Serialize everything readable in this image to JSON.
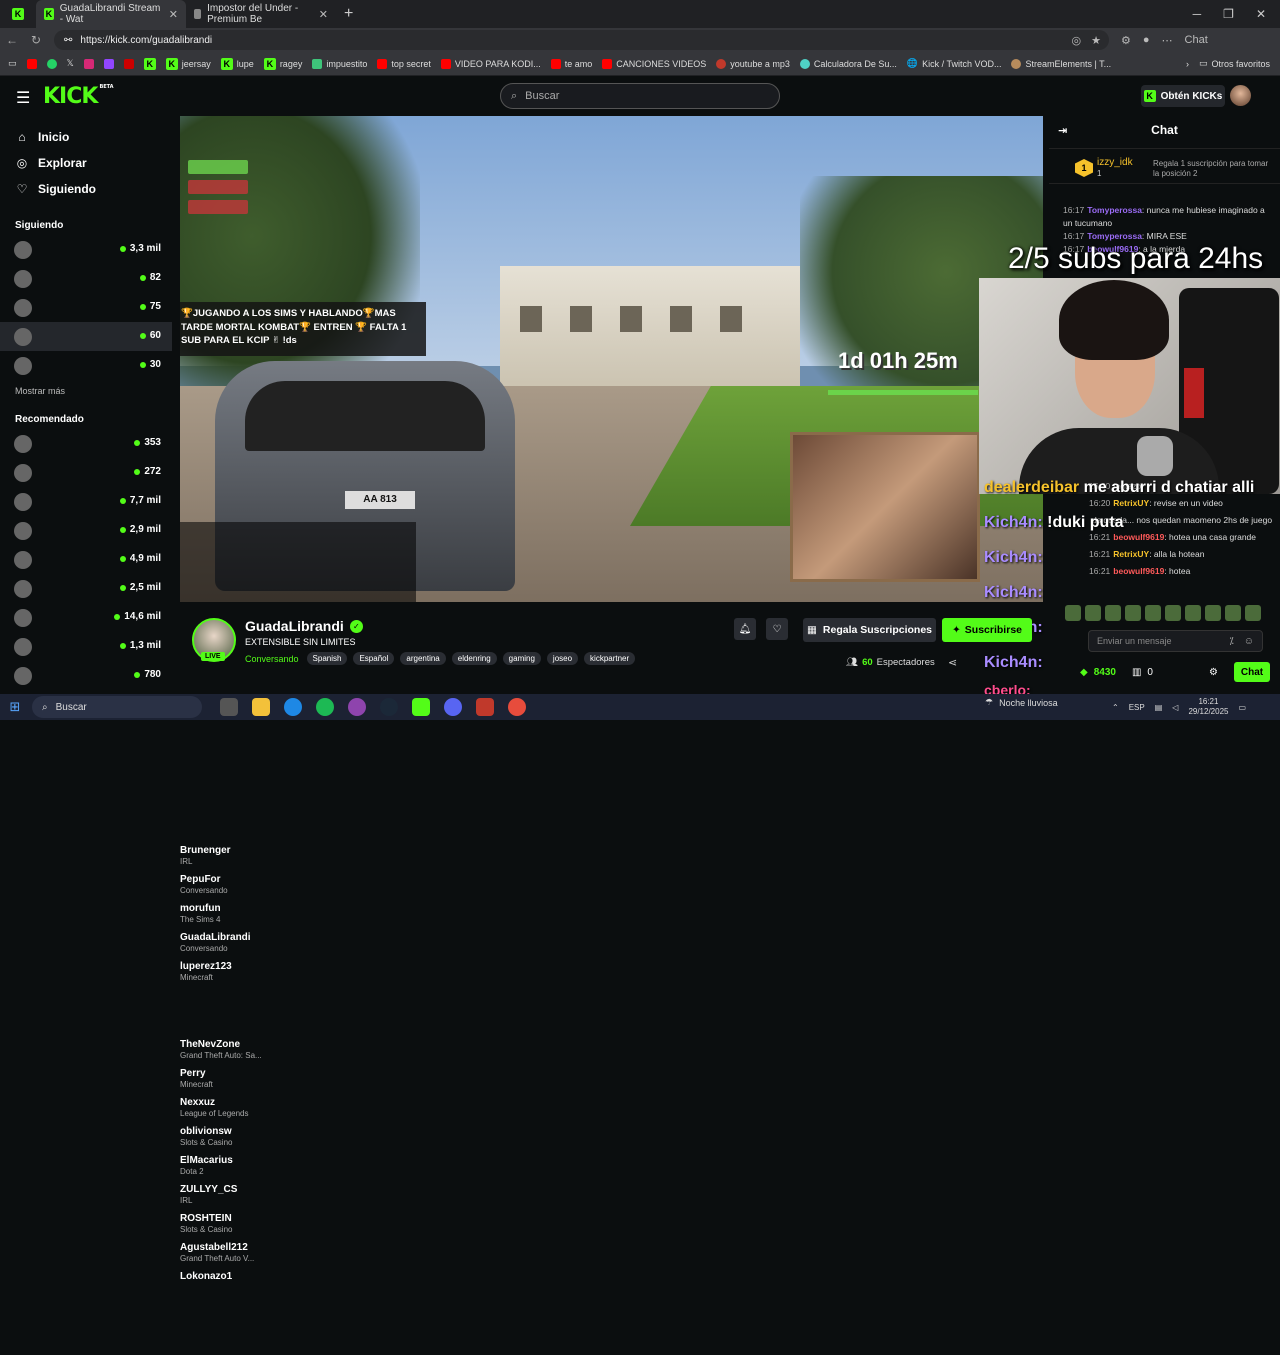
{
  "browser": {
    "tabs": [
      {
        "label": "GuadaLibrandi Stream - Wat",
        "active": true
      },
      {
        "label": "Impostor del Under - Premium Be",
        "active": false
      }
    ],
    "url": "https://kick.com/guadalibrandi",
    "chat_button": "Chat",
    "bookmarks": [
      "jeersay",
      "lupe",
      "ragey",
      "impuestito",
      "top secret",
      "VIDEO PARA KODI...",
      "te amo",
      "CANCIONES VIDEOS",
      "youtube a mp3",
      "Calculadora De Su...",
      "Kick / Twitch VOD...",
      "StreamElements | T..."
    ],
    "other_favorites": "Otros favoritos"
  },
  "header": {
    "logo": "KICK",
    "logo_badge": "BETA",
    "search_placeholder": "Buscar",
    "get_kicks": "Obtén KICKs"
  },
  "sidebar": {
    "nav": [
      {
        "label": "Inicio",
        "icon": "home-icon"
      },
      {
        "label": "Explorar",
        "icon": "compass-icon"
      },
      {
        "label": "Siguiendo",
        "icon": "heart-icon"
      }
    ],
    "following_title": "Siguiendo",
    "following": [
      {
        "name": "Brunenger",
        "sub": "IRL",
        "count": "3,3 mil"
      },
      {
        "name": "PepuFor",
        "sub": "Conversando",
        "count": "82"
      },
      {
        "name": "morufun",
        "sub": "The Sims 4",
        "count": "75"
      },
      {
        "name": "GuadaLibrandi",
        "sub": "Conversando",
        "count": "60"
      },
      {
        "name": "luperez123",
        "sub": "Minecraft",
        "count": "30"
      }
    ],
    "show_more": "Mostrar más",
    "recommended_title": "Recomendado",
    "recommended": [
      {
        "name": "TheNevZone",
        "sub": "Grand Theft Auto: Sa...",
        "count": "353"
      },
      {
        "name": "Perry",
        "sub": "Minecraft",
        "count": "272"
      },
      {
        "name": "Nexxuz",
        "sub": "League of Legends",
        "count": "7,7 mil"
      },
      {
        "name": "oblivionsw",
        "sub": "Slots & Casino",
        "count": "2,9 mil"
      },
      {
        "name": "ElMacarius",
        "sub": "Dota 2",
        "count": "4,9 mil"
      },
      {
        "name": "ZULLYY_CS",
        "sub": "IRL",
        "count": "2,5 mil"
      },
      {
        "name": "ROSHTEIN",
        "sub": "Slots & Casino",
        "count": "14,6 mil"
      },
      {
        "name": "Agustabell212",
        "sub": "Grand Theft Auto V...",
        "count": "1,3 mil"
      },
      {
        "name": "Lokonazo1",
        "sub": "",
        "count": "780"
      }
    ]
  },
  "video": {
    "overlay_title_lines": [
      "🏆JUGANDO A LOS SIMS Y HABLANDO🏆MAS",
      "TARDE MORTAL KOMBAT🏆 ENTREN 🏆 FALTA 1",
      "SUB PARA EL KCIP ✌ !ds"
    ],
    "timer": "1d 01h 25m",
    "subs_goal": "2/5 subs para 24hs"
  },
  "chat": {
    "title": "Chat",
    "pinned": {
      "user": "izzy_idk",
      "count": "1",
      "gift_text": "Regala 1 suscripción para tomar la posición 2"
    },
    "messages": [
      {
        "time": "16:17",
        "user": "Tomyperossa",
        "text": ": nunca me hubiese imaginado a un tucumano"
      },
      {
        "time": "16:17",
        "user": "Tomyperossa",
        "text": ": MIRA ESE"
      },
      {
        "time": "16:17",
        "user": "beowulf9619",
        "text": ": a la mierda"
      }
    ],
    "lower_messages": [
      {
        "time": "16:20",
        "user": "",
        "text": "tagtazo"
      },
      {
        "time": "16:20",
        "user": "RetrixUY",
        "text": ": revise en un video"
      },
      {
        "time": "",
        "user": "",
        "text": "ds queda... nos quedan maomeno 2hs de juego"
      },
      {
        "time": "16:21",
        "user": "beowulf9619",
        "text": ": hotea una casa grande"
      },
      {
        "time": "16:21",
        "user": "RetrixUY",
        "text": ": alla la hotean"
      },
      {
        "time": "16:21",
        "user": "beowulf9619",
        "text": ": hotea"
      }
    ],
    "overlay_lines": [
      {
        "name": "dealerdeibar",
        "text": " me aburri d chatiar alli"
      },
      {
        "name": "Kich4n:",
        "text": " !duki puta"
      },
      {
        "name": "Kich4n:",
        "text": ""
      },
      {
        "name": "Kich4n:",
        "text": ""
      },
      {
        "name": "Kich4n:",
        "text": ""
      },
      {
        "name": "Kich4n:",
        "text": ""
      }
    ],
    "bottom_overlay": "cberlo:",
    "input_placeholder": "Enviar un mensaje",
    "points": "8430",
    "zero": "0",
    "send_button": "Chat"
  },
  "stream": {
    "name": "GuadaLibrandi",
    "title": "EXTENSIBLE SIN LIMITES",
    "category": "Conversando",
    "tags": [
      "Spanish",
      "Español",
      "argentina",
      "eldenring",
      "gaming",
      "joseo",
      "kickpartner"
    ],
    "live": "LIVE",
    "gift_button": "Regala Suscripciones",
    "subscribe_button": "Suscribirse",
    "viewers_count": "60",
    "viewers_label": "Espectadores"
  },
  "taskbar": {
    "search": "Buscar",
    "weather": "Noche lluviosa",
    "lang": "ESP",
    "time": "16:21",
    "date": "29/12/2025"
  }
}
